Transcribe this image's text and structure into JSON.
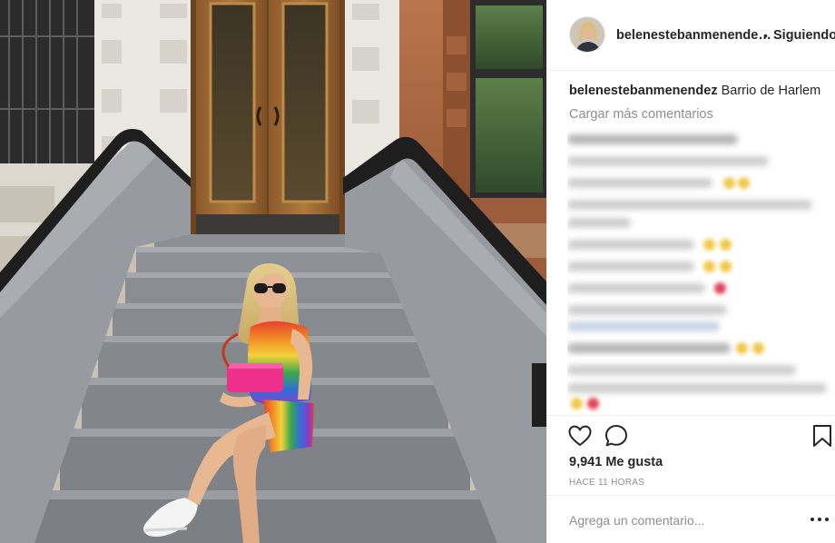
{
  "post": {
    "username": "belenestebanmenende…",
    "separator": "•",
    "follow_status": "Siguiendo",
    "caption_user": "belenestebanmenendez",
    "caption_text": "Barrio de Harlem",
    "load_more": "Cargar más comentarios",
    "likes": "9,941 Me gusta",
    "timestamp": "HACE 11 HORAS",
    "comment_placeholder": "Agrega un comentario..."
  },
  "icons": {
    "like": "heart-icon",
    "comment": "speech-bubble-icon",
    "save": "bookmark-icon",
    "more": "more-options-icon"
  },
  "colors": {
    "text": "#262626",
    "secondary": "#8e8e8e",
    "divider": "#efefef"
  }
}
